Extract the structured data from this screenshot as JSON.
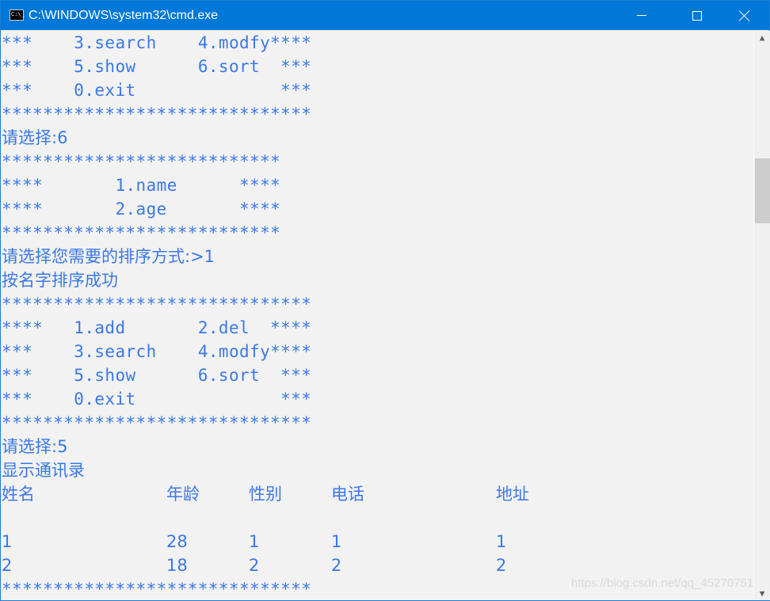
{
  "window": {
    "title": "C:\\WINDOWS\\system32\\cmd.exe",
    "app_icon_text": "C:\\_",
    "controls": {
      "minimize": "minimize",
      "maximize": "maximize",
      "close": "close"
    }
  },
  "console": {
    "lines": [
      "***    3.search    4.modfy****",
      "***    5.show      6.sort  ***",
      "***    0.exit              ***",
      "******************************",
      "请选择:6",
      "***************************",
      "****       1.name      ****",
      "****       2.age       ****",
      "***************************",
      "请选择您需要的排序方式:>1",
      "按名字排序成功",
      "******************************",
      "****   1.add       2.del  ****",
      "***    3.search    4.modfy****",
      "***    5.show      6.sort  ***",
      "***    0.exit              ***",
      "******************************",
      "请选择:5",
      "显示通讯录"
    ],
    "table": {
      "headers": [
        "姓名",
        "年龄",
        "性别",
        "电话",
        "地址"
      ],
      "rows": [
        [
          "1",
          "28",
          "1",
          "1",
          "1"
        ],
        [
          "2",
          "18",
          "2",
          "2",
          "2"
        ]
      ]
    },
    "footer_line": "******************************"
  },
  "scrollbar": {
    "up_arrow": "▲",
    "down_arrow": "▼",
    "position_fraction": 0.23
  },
  "watermark": "https://blog.csdn.net/qq_45270751",
  "colors": {
    "text": "#3b78e7",
    "background": "#f2f2f2",
    "titlebar": "#0078d7"
  }
}
